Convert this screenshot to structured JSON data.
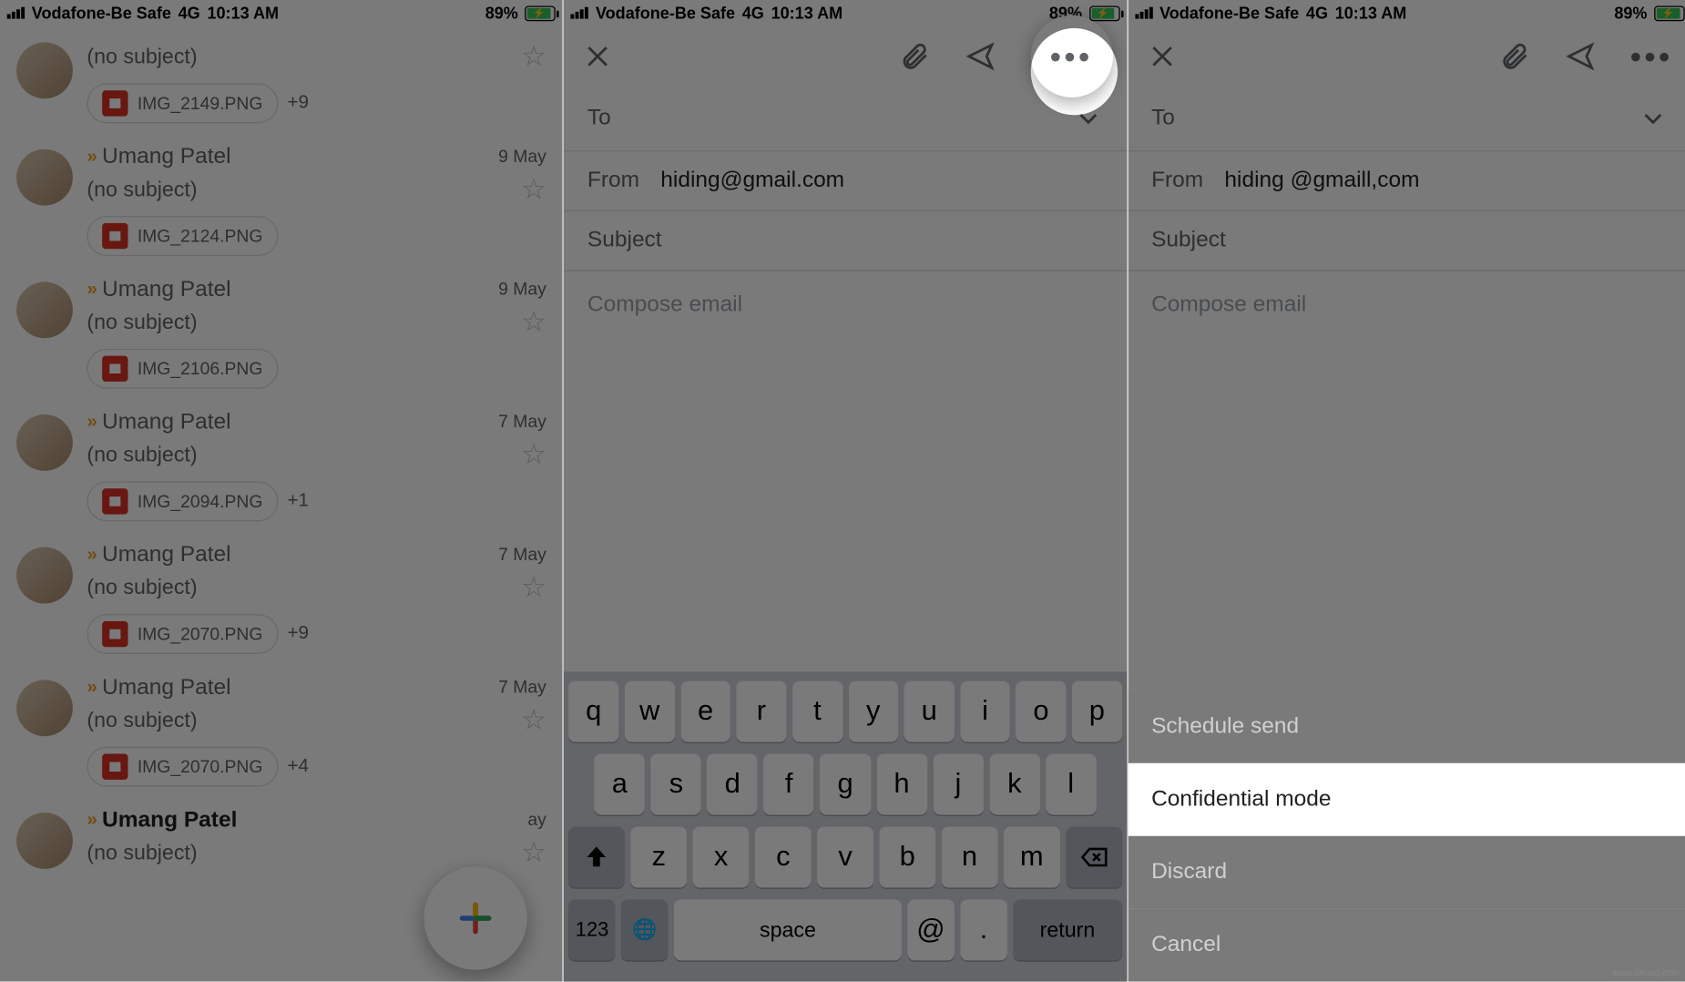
{
  "status": {
    "carrier": "Vodafone-Be Safe",
    "network": "4G",
    "time": "10:13 AM",
    "battery_pct": "89%"
  },
  "inbox": [
    {
      "sender": "",
      "subject": "(no subject)",
      "date": "",
      "attachment": "IMG_2149.PNG",
      "extra": "+9"
    },
    {
      "sender": "Umang Patel",
      "subject": "(no subject)",
      "date": "9 May",
      "attachment": "IMG_2124.PNG",
      "extra": ""
    },
    {
      "sender": "Umang Patel",
      "subject": "(no subject)",
      "date": "9 May",
      "attachment": "IMG_2106.PNG",
      "extra": ""
    },
    {
      "sender": "Umang Patel",
      "subject": "(no subject)",
      "date": "7 May",
      "attachment": "IMG_2094.PNG",
      "extra": "+1"
    },
    {
      "sender": "Umang Patel",
      "subject": "(no subject)",
      "date": "7 May",
      "attachment": "IMG_2070.PNG",
      "extra": "+9"
    },
    {
      "sender": "Umang Patel",
      "subject": "(no subject)",
      "date": "7 May",
      "attachment": "IMG_2070.PNG",
      "extra": "+4"
    },
    {
      "sender": "Umang Patel",
      "subject": "(no subject)",
      "date": "ay",
      "attachment": "",
      "extra": "",
      "bold": true
    }
  ],
  "compose": {
    "to_label": "To",
    "from_label": "From",
    "from_value_p2": "hiding@gmail.com",
    "from_value_p3": "hiding @gmaill,com",
    "subject_ph": "Subject",
    "body_ph": "Compose email"
  },
  "keyboard": {
    "row1": [
      "q",
      "w",
      "e",
      "r",
      "t",
      "y",
      "u",
      "i",
      "o",
      "p"
    ],
    "row2": [
      "a",
      "s",
      "d",
      "f",
      "g",
      "h",
      "j",
      "k",
      "l"
    ],
    "row3": [
      "z",
      "x",
      "c",
      "v",
      "b",
      "n",
      "m"
    ],
    "num": "123",
    "at": "@",
    "dot": ".",
    "space": "space",
    "return": "return"
  },
  "sheet": {
    "schedule": "Schedule send",
    "confidential": "Confidential mode",
    "discard": "Discard",
    "cancel": "Cancel"
  },
  "watermark": "www.deuaq.com"
}
